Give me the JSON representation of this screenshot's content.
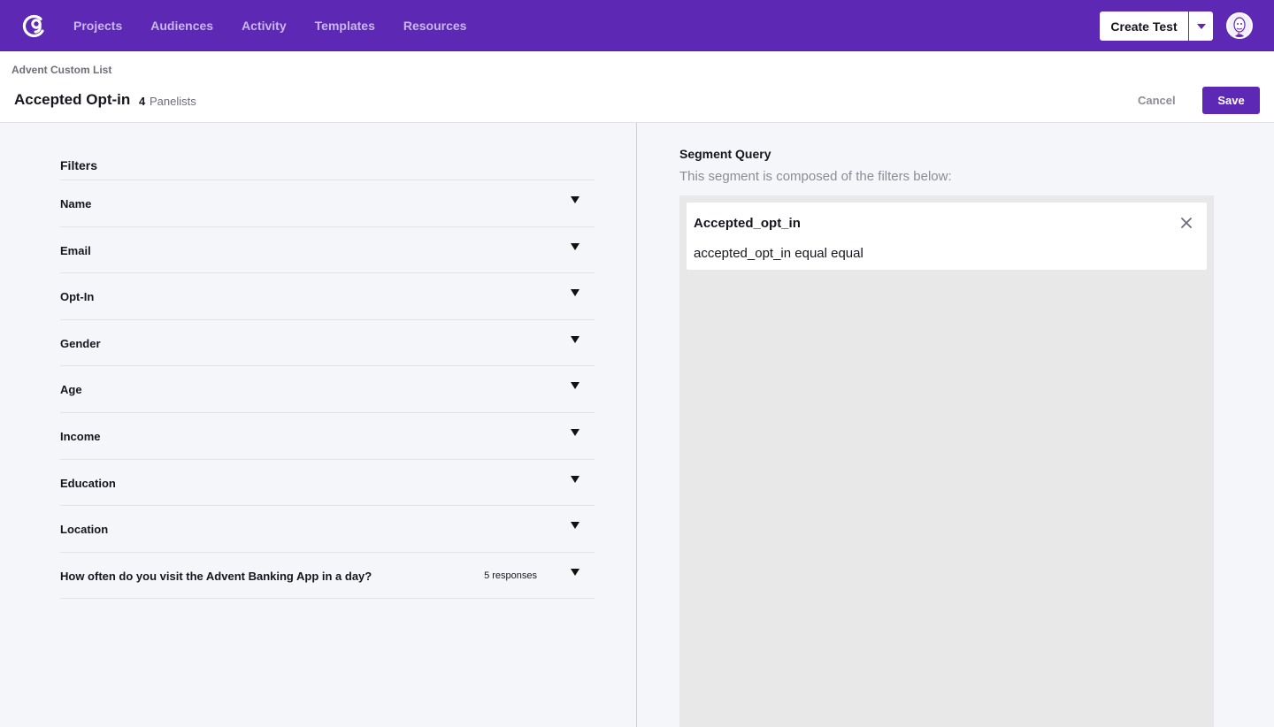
{
  "topbar": {
    "logo_icon": "brand-logo-icon",
    "nav": [
      "Projects",
      "Audiences",
      "Activity",
      "Templates",
      "Resources"
    ],
    "create_test_label": "Create Test",
    "create_test_caret_icon": "caret-down-icon",
    "avatar_icon": "user-avatar"
  },
  "subheader": {
    "breadcrumb": "Advent Custom List",
    "title": "Accepted Opt-in",
    "panelist_count": "4",
    "panelist_label": "Panelists",
    "cancel_label": "Cancel",
    "save_label": "Save"
  },
  "filters": {
    "title": "Filters",
    "items": [
      {
        "label": "Name",
        "meta": ""
      },
      {
        "label": "Email",
        "meta": ""
      },
      {
        "label": "Opt-In",
        "meta": ""
      },
      {
        "label": "Gender",
        "meta": ""
      },
      {
        "label": "Age",
        "meta": ""
      },
      {
        "label": "Income",
        "meta": ""
      },
      {
        "label": "Education",
        "meta": ""
      },
      {
        "label": "Location",
        "meta": ""
      },
      {
        "label": "How often do you visit the Advent Banking App in a day?",
        "meta": "5 responses"
      }
    ]
  },
  "segment": {
    "title": "Segment Query",
    "subtitle": "This segment is composed of the filters below:",
    "queries": [
      {
        "title": "Accepted_opt_in",
        "description": "accepted_opt_in equal equal"
      }
    ]
  },
  "colors": {
    "brand": "#5d29b4",
    "nav_text": "#c9b8ec",
    "query_area": "#e8e8e8"
  }
}
